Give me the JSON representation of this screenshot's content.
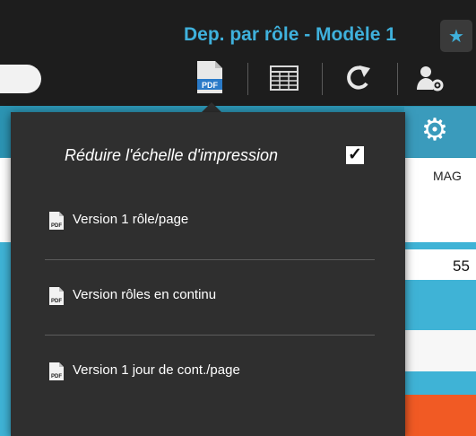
{
  "window": {
    "title": "Dep. par rôle - Modèle 1",
    "favorite_icon": "star-icon"
  },
  "toolbar": {
    "pdf_icon": "pdf-export-icon",
    "pdf_icon_text": "PDF",
    "table_icon": "table-icon",
    "refresh_icon": "refresh-icon",
    "user_settings_icon": "user-settings-icon"
  },
  "settings_tab": {
    "icon": "gear-icon"
  },
  "table": {
    "column_header_partial": "MAG",
    "visible_value": "55"
  },
  "pdf_menu": {
    "scale_label": "Réduire l'échelle d'impression",
    "scale_checked": true,
    "items": [
      {
        "label": "Version 1 rôle/page",
        "icon": "pdf-file-icon"
      },
      {
        "label": "Version rôles en continu",
        "icon": "pdf-file-icon"
      },
      {
        "label": "Version 1 jour de cont./page",
        "icon": "pdf-file-icon"
      }
    ]
  },
  "colors": {
    "accent": "#3fb1dc",
    "row_blue": "#3fb3d6",
    "orange": "#f15a24",
    "menu_bg": "#2f2f2f"
  }
}
